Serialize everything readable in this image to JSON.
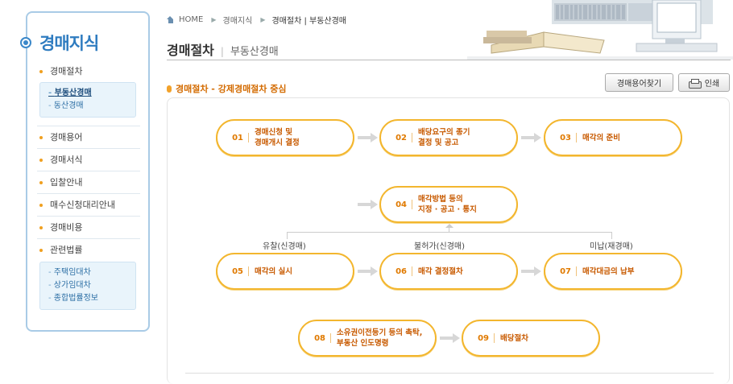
{
  "sidebar": {
    "title": "경매지식",
    "menu": [
      {
        "label": "경매절차"
      },
      {
        "label": "경매용어"
      },
      {
        "label": "경매서식"
      },
      {
        "label": "입찰안내"
      },
      {
        "label": "매수신청대리안내"
      },
      {
        "label": "경매비용"
      },
      {
        "label": "관련법률"
      }
    ],
    "submenu1": [
      "부동산경매",
      "동산경매"
    ],
    "submenu2": [
      "주택임대차",
      "상가임대차",
      "종합법률정보"
    ]
  },
  "breadcrumb": {
    "home": "HOME",
    "level1": "경매지식",
    "level2": "경매절차 | 부동산경매"
  },
  "page_title": {
    "main": "경매절차",
    "sub": "부동산경매"
  },
  "section_title": "경매절차 - 강제경매절차 중심",
  "buttons": {
    "glossary": "경매용어찾기",
    "print": "인쇄"
  },
  "steps": [
    {
      "num": "01",
      "label": "경매신청 및\n경매개시 결정"
    },
    {
      "num": "02",
      "label": "배당요구의 종기\n결정 및 공고"
    },
    {
      "num": "03",
      "label": "매각의 준비"
    },
    {
      "num": "04",
      "label": "매각방법 등의\n지정 · 공고 · 통지"
    },
    {
      "num": "05",
      "label": "매각의 실시"
    },
    {
      "num": "06",
      "label": "매각 결정절차"
    },
    {
      "num": "07",
      "label": "매각대금의 납부"
    },
    {
      "num": "08",
      "label": "소유권이전등기 등의 촉탁,\n부동산 인도명령"
    },
    {
      "num": "09",
      "label": "배당절차"
    }
  ],
  "branches": {
    "left": "유찰(신경매)",
    "middle": "불허가(신경매)",
    "right": "미납(재경매)"
  },
  "colors": {
    "accent_blue": "#2f7cc0",
    "accent_orange": "#f3b62e",
    "label_orange": "#c85a00"
  }
}
